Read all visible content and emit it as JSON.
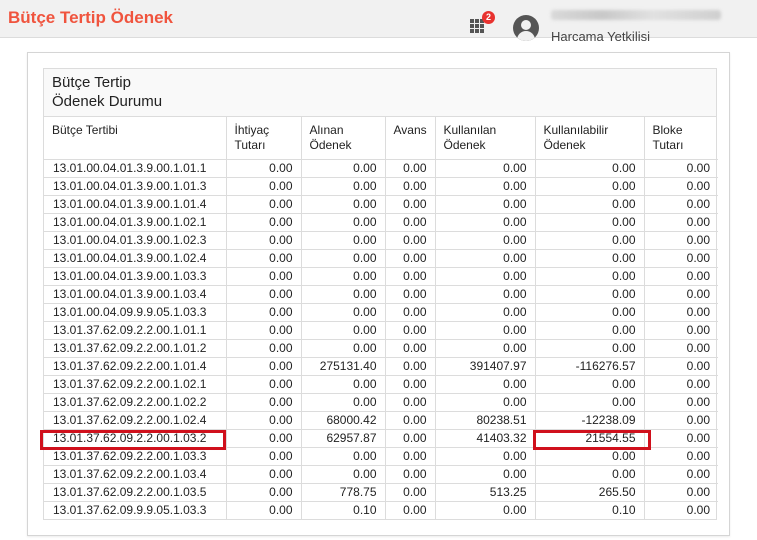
{
  "app": {
    "title": "Bütçe Tertip Ödenek"
  },
  "header": {
    "notification_count": "2",
    "user_role": "Harcama Yetkilisi",
    "apps_icon": "grid-icon",
    "avatar_icon": "user-avatar-icon"
  },
  "panel": {
    "title_line1": "Bütçe Tertip",
    "title_line2": "Ödenek Durumu"
  },
  "table": {
    "headers": {
      "tertip": "Bütçe Tertibi",
      "ihtiyac_1": "İhtiyaç",
      "ihtiyac_2": "Tutarı",
      "alinan_1": "Alınan",
      "alinan_2": "Ödenek",
      "avans": "Avans",
      "kullanilan_1": "Kullanılan",
      "kullanilan_2": "Ödenek",
      "kullanilabilir_1": "Kullanılabilir",
      "kullanilabilir_2": "Ödenek",
      "bloke_1": "Bloke",
      "bloke_2": "Tutarı"
    },
    "rows": [
      [
        "13.01.00.04.01.3.9.00.1.01.1",
        "0.00",
        "0.00",
        "0.00",
        "0.00",
        "0.00",
        "0.00"
      ],
      [
        "13.01.00.04.01.3.9.00.1.01.3",
        "0.00",
        "0.00",
        "0.00",
        "0.00",
        "0.00",
        "0.00"
      ],
      [
        "13.01.00.04.01.3.9.00.1.01.4",
        "0.00",
        "0.00",
        "0.00",
        "0.00",
        "0.00",
        "0.00"
      ],
      [
        "13.01.00.04.01.3.9.00.1.02.1",
        "0.00",
        "0.00",
        "0.00",
        "0.00",
        "0.00",
        "0.00"
      ],
      [
        "13.01.00.04.01.3.9.00.1.02.3",
        "0.00",
        "0.00",
        "0.00",
        "0.00",
        "0.00",
        "0.00"
      ],
      [
        "13.01.00.04.01.3.9.00.1.02.4",
        "0.00",
        "0.00",
        "0.00",
        "0.00",
        "0.00",
        "0.00"
      ],
      [
        "13.01.00.04.01.3.9.00.1.03.3",
        "0.00",
        "0.00",
        "0.00",
        "0.00",
        "0.00",
        "0.00"
      ],
      [
        "13.01.00.04.01.3.9.00.1.03.4",
        "0.00",
        "0.00",
        "0.00",
        "0.00",
        "0.00",
        "0.00"
      ],
      [
        "13.01.00.04.09.9.9.05.1.03.3",
        "0.00",
        "0.00",
        "0.00",
        "0.00",
        "0.00",
        "0.00"
      ],
      [
        "13.01.37.62.09.2.2.00.1.01.1",
        "0.00",
        "0.00",
        "0.00",
        "0.00",
        "0.00",
        "0.00"
      ],
      [
        "13.01.37.62.09.2.2.00.1.01.2",
        "0.00",
        "0.00",
        "0.00",
        "0.00",
        "0.00",
        "0.00"
      ],
      [
        "13.01.37.62.09.2.2.00.1.01.4",
        "0.00",
        "275131.40",
        "0.00",
        "391407.97",
        "-116276.57",
        "0.00"
      ],
      [
        "13.01.37.62.09.2.2.00.1.02.1",
        "0.00",
        "0.00",
        "0.00",
        "0.00",
        "0.00",
        "0.00"
      ],
      [
        "13.01.37.62.09.2.2.00.1.02.2",
        "0.00",
        "0.00",
        "0.00",
        "0.00",
        "0.00",
        "0.00"
      ],
      [
        "13.01.37.62.09.2.2.00.1.02.4",
        "0.00",
        "68000.42",
        "0.00",
        "80238.51",
        "-12238.09",
        "0.00"
      ],
      [
        "13.01.37.62.09.2.2.00.1.03.2",
        "0.00",
        "62957.87",
        "0.00",
        "41403.32",
        "21554.55",
        "0.00"
      ],
      [
        "13.01.37.62.09.2.2.00.1.03.3",
        "0.00",
        "0.00",
        "0.00",
        "0.00",
        "0.00",
        "0.00"
      ],
      [
        "13.01.37.62.09.2.2.00.1.03.4",
        "0.00",
        "0.00",
        "0.00",
        "0.00",
        "0.00",
        "0.00"
      ],
      [
        "13.01.37.62.09.2.2.00.1.03.5",
        "0.00",
        "778.75",
        "0.00",
        "513.25",
        "265.50",
        "0.00"
      ],
      [
        "13.01.37.62.09.9.9.05.1.03.3",
        "0.00",
        "0.10",
        "0.00",
        "0.00",
        "0.10",
        "0.00"
      ]
    ]
  },
  "colors": {
    "accent": "#f0543e",
    "highlight": "#d0101c",
    "badge": "#e8322f"
  }
}
